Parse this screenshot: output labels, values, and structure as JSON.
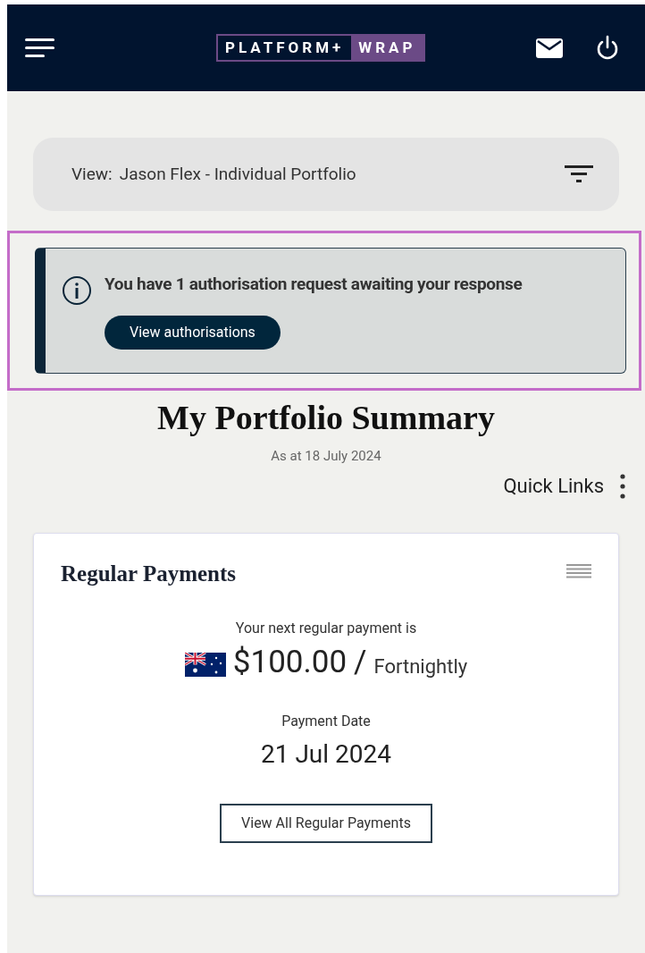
{
  "header": {
    "logo": {
      "left": "PLATFORM+",
      "right": "WRAP"
    }
  },
  "view_selector": {
    "label": "View:",
    "value": "Jason Flex - Individual Portfolio"
  },
  "alert": {
    "message": "You have 1 authorisation request awaiting your response",
    "button": "View authorisations",
    "highlighted": true
  },
  "summary": {
    "title": "My Portfolio Summary",
    "as_at": "As at  18 July 2024",
    "quick_links": "Quick Links"
  },
  "regular_payments": {
    "title": "Regular Payments",
    "intro": "Your next regular payment is",
    "amount": "$100.00",
    "separator": "/",
    "frequency": "Fortnightly",
    "date_label": "Payment Date",
    "date": "21 Jul 2024",
    "button": "View All Regular Payments"
  }
}
